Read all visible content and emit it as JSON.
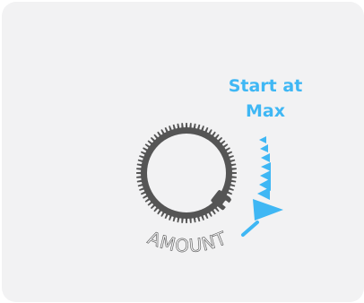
{
  "hint": {
    "line1": "Start at",
    "line2": "Max"
  },
  "knob": {
    "label": "AMOUNT",
    "setting": "max"
  },
  "colors": {
    "accent": "#3fb7f4",
    "knob": "#555555",
    "card": "#f2f2f3"
  }
}
